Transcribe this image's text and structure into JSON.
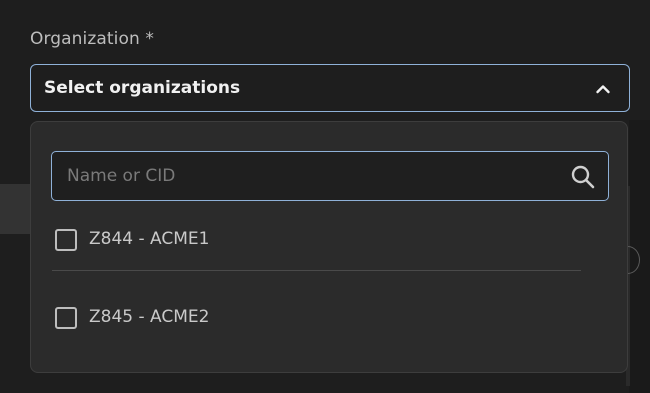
{
  "field": {
    "label": "Organization *",
    "select_text": "Select organizations",
    "chevron_icon": "chevron-up-icon"
  },
  "dropdown": {
    "search": {
      "placeholder": "Name or CID",
      "value": "",
      "icon": "search-icon"
    },
    "options": [
      {
        "label": "Z844 - ACME1",
        "checked": false
      },
      {
        "label": "Z845 - ACME2",
        "checked": false
      }
    ]
  },
  "colors": {
    "background": "#1e1e1e",
    "panel": "#2b2b2b",
    "accent_border": "#8fb1d8",
    "text": "#c9c9c9"
  }
}
